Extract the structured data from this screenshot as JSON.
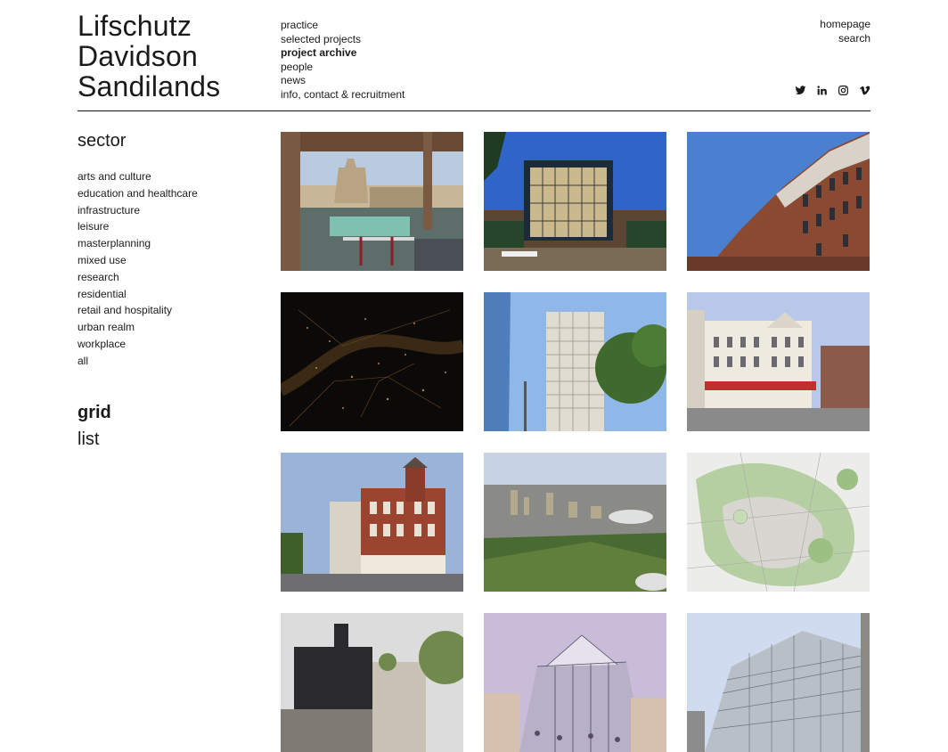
{
  "logo": {
    "line1": "Lifschutz",
    "line2": "Davidson",
    "line3": "Sandilands"
  },
  "main_nav": {
    "items": [
      {
        "label": "practice"
      },
      {
        "label": "selected projects"
      },
      {
        "label": "project archive",
        "active": true
      },
      {
        "label": "people"
      },
      {
        "label": "news"
      },
      {
        "label": "info, contact & recruitment"
      }
    ]
  },
  "util_nav": {
    "homepage": "homepage",
    "search": "search"
  },
  "social_icons": [
    "twitter-icon",
    "linkedin-icon",
    "instagram-icon",
    "vimeo-icon"
  ],
  "sidebar": {
    "title": "sector",
    "sectors": [
      "arts and culture",
      "education and healthcare",
      "infrastructure",
      "leisure",
      "masterplanning",
      "mixed use",
      "research",
      "residential",
      "retail and hospitality",
      "urban realm",
      "workplace",
      "all"
    ],
    "view": {
      "grid": "grid",
      "list": "list",
      "active": "grid"
    }
  },
  "colors": {
    "text": "#1a1a1a",
    "background": "#ffffff",
    "rule": "#1a1a1a"
  },
  "projects": [
    {
      "image": "rooftop-terrace-restaurant"
    },
    {
      "image": "glass-cube-entrance-at-dusk"
    },
    {
      "image": "brick-residential-block"
    },
    {
      "image": "aerial-city-at-night"
    },
    {
      "image": "white-office-tower"
    },
    {
      "image": "white-stucco-corner-building"
    },
    {
      "image": "red-brick-victorian-corner"
    },
    {
      "image": "aerial-park-city-view"
    },
    {
      "image": "masterplan-drawing"
    },
    {
      "image": "dark-clad-building"
    },
    {
      "image": "market-hall-sketch"
    },
    {
      "image": "glass-office-facade"
    }
  ]
}
